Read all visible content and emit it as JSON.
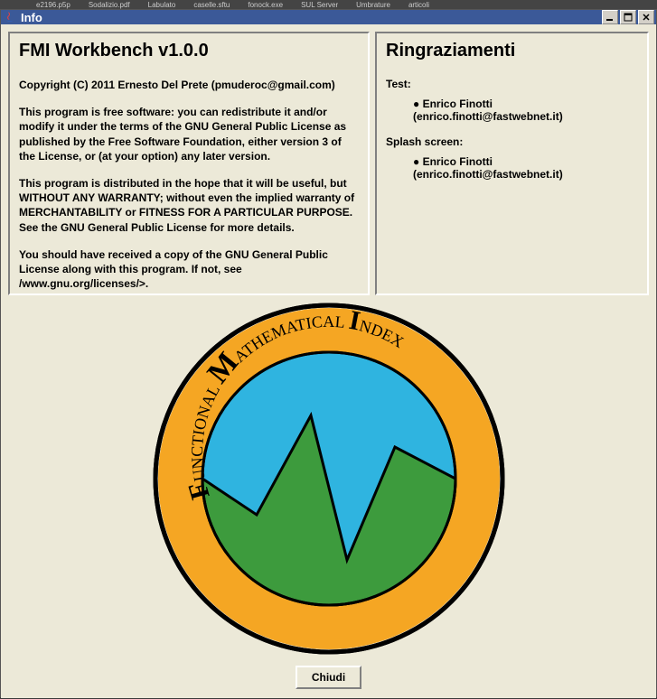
{
  "taskbar": {
    "items": [
      "e2196.p5p",
      "Sodalizio.pdf",
      "Labulato",
      "caselle.sftu",
      "fonock.exe",
      "SUL Server",
      "Umbrature",
      "articoli"
    ]
  },
  "window": {
    "title": "Info"
  },
  "left_panel": {
    "heading": "FMI Workbench v1.0.0",
    "copyright": "Copyright (C) 2011 Ernesto Del Prete (pmuderoc@gmail.com)",
    "para1": "This program is free software: you can redistribute it and/or modify it under the terms of the GNU General Public License as published by the Free Software Foundation, either version 3 of the License, or (at your option) any later version.",
    "para2": "This program is distributed in the hope that it will be useful, but WITHOUT ANY WARRANTY; without even the implied warranty of MERCHANTABILITY or FITNESS FOR A PARTICULAR PURPOSE. See the GNU General Public License for more details.",
    "para3": "You should have received a copy of the GNU General Public License along with this program. If not, see /www.gnu.org/licenses/>."
  },
  "right_panel": {
    "heading": "Ringraziamenti",
    "test_label": "Test:",
    "test_credit": "● Enrico Finotti (enrico.finotti@fastwebnet.it)",
    "splash_label": "Splash screen:",
    "splash_credit": "● Enrico Finotti (enrico.finotti@fastwebnet.it)"
  },
  "logo": {
    "text_top": "FUNCTIONAL MATHEMATICAL INDEX",
    "letters": {
      "f": "F",
      "unctional": "UNCTIONAL",
      "m": "M",
      "athematical": "ATHEMATICAL",
      "i": "I",
      "ndex": "NDEX"
    }
  },
  "button": {
    "close": "Chiudi"
  }
}
